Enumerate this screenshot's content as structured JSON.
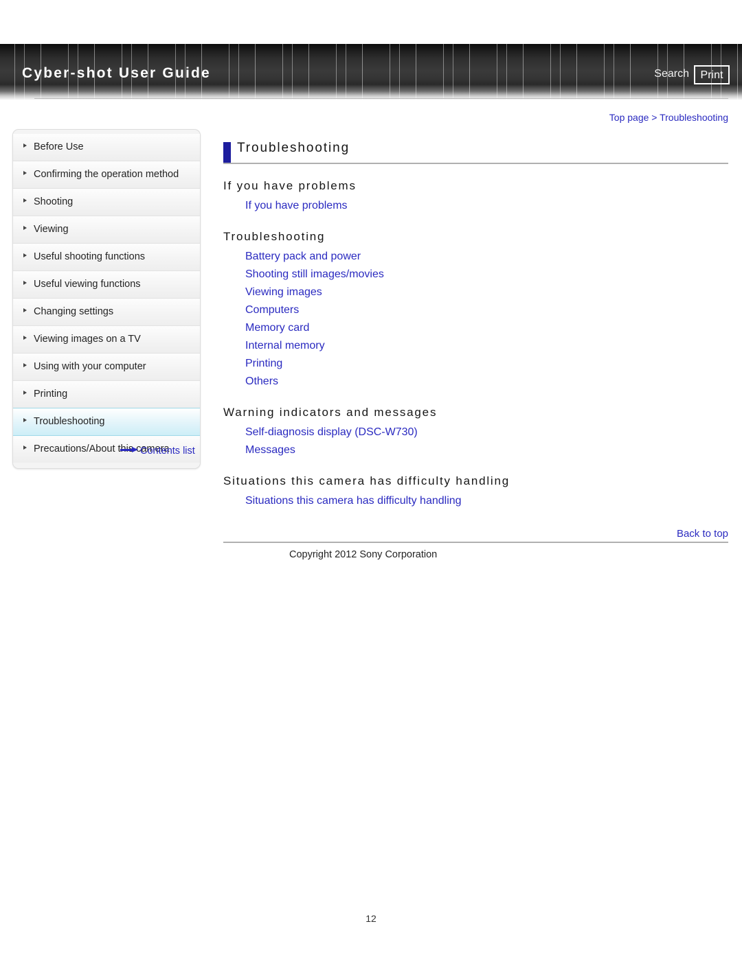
{
  "header": {
    "brand": "Cyber-shot User Guide",
    "search_label": "Search",
    "print_label": "Print"
  },
  "breadcrumb": "Top page > Troubleshooting",
  "sidebar": {
    "items": [
      {
        "label": "Before Use",
        "active": false
      },
      {
        "label": "Confirming the operation method",
        "active": false
      },
      {
        "label": "Shooting",
        "active": false
      },
      {
        "label": "Viewing",
        "active": false
      },
      {
        "label": "Useful shooting functions",
        "active": false
      },
      {
        "label": "Useful viewing functions",
        "active": false
      },
      {
        "label": "Changing settings",
        "active": false
      },
      {
        "label": "Viewing images on a TV",
        "active": false
      },
      {
        "label": "Using with your computer",
        "active": false
      },
      {
        "label": "Printing",
        "active": false
      },
      {
        "label": "Troubleshooting",
        "active": true
      },
      {
        "label": "Precautions/About this camera",
        "active": false
      }
    ],
    "contents_list_label": "Contents list"
  },
  "main": {
    "page_title": "Troubleshooting",
    "sections": [
      {
        "heading": "If you have problems",
        "links": [
          "If you have problems"
        ]
      },
      {
        "heading": "Troubleshooting",
        "links": [
          "Battery pack and power",
          "Shooting still images/movies",
          "Viewing images",
          "Computers",
          "Memory card",
          "Internal memory",
          "Printing",
          "Others"
        ]
      },
      {
        "heading": "Warning indicators and messages",
        "links": [
          "Self-diagnosis display (DSC-W730)",
          "Messages"
        ]
      },
      {
        "heading": "Situations this camera has difficulty handling",
        "links": [
          "Situations this camera has difficulty handling"
        ]
      }
    ],
    "back_to_top": "Back to top",
    "copyright": "Copyright 2012 Sony Corporation"
  },
  "page_number": "12",
  "colors": {
    "link": "#2a2ac0",
    "title_accent": "#1d1d9e",
    "active_nav": "#cdeef7"
  }
}
